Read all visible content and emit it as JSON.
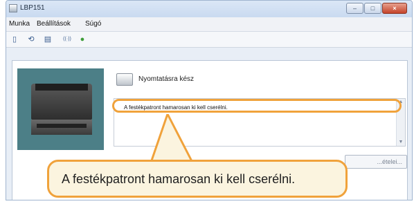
{
  "window": {
    "title": "LBP151",
    "controls": {
      "minimize_label": "–",
      "maximize_label": "□",
      "close_label": "×"
    }
  },
  "menubar": {
    "items": [
      {
        "label": "Munka"
      },
      {
        "label": "Beállítások"
      },
      {
        "label": "Súgó"
      }
    ]
  },
  "toolbar": {
    "icons": [
      {
        "name": "page-view-icon",
        "glyph": "▯"
      },
      {
        "name": "refresh-icon",
        "glyph": "⟲"
      },
      {
        "name": "print-queue-icon",
        "glyph": "▤"
      },
      {
        "name": "network-icon",
        "glyph": "((·))"
      },
      {
        "name": "globe-icon",
        "glyph": "●"
      }
    ]
  },
  "status": {
    "text": "Nyomtatásra kész"
  },
  "messages": {
    "line1": "A festékpatront hamarosan ki kell cserélni.",
    "line2": ""
  },
  "details_button": {
    "label": "...ételei..."
  },
  "callout": {
    "text": "A festékpatront hamarosan ki kell cserélni."
  },
  "colors": {
    "highlight": "#f0a23b",
    "callout_bg": "#fbf4df"
  }
}
